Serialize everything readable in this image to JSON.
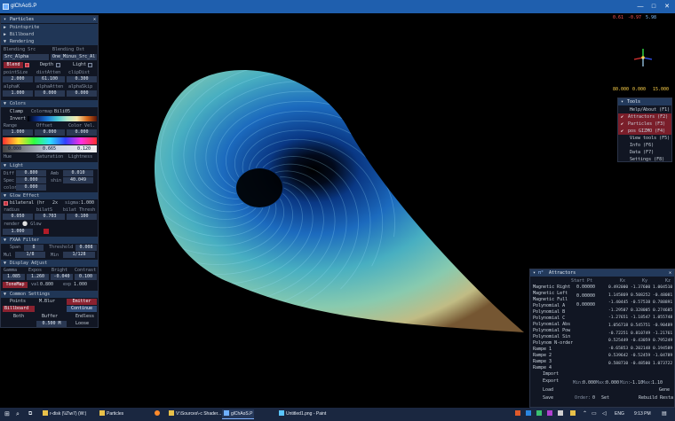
{
  "window": {
    "title": "glChAoS.P",
    "min": "—",
    "max": "□",
    "close": "✕"
  },
  "fps": {
    "v1": "0.61",
    "v2": "-0.97",
    "v3": "5.98"
  },
  "zoom": {
    "a": "80.000",
    "b": "0.000",
    "c": "15.000"
  },
  "left_panel": {
    "title": "Particles",
    "close": "✕",
    "sections": {
      "pointsprite": "Pointsprite",
      "billboard": "Billboard",
      "rendering": "Rendering"
    },
    "blending_src_label": "Blending Src",
    "blending_dst_label": "Blending Dst",
    "blending_src": "Src_Alpha",
    "blending_dst": "One_Minus_Src_Al",
    "blend_btn": "Blend",
    "depth_label": "Depth",
    "light_label": "Light",
    "point_size_label": "pointSize",
    "dist_alpha_label": "distAtten",
    "clipping_label": "clipDist",
    "point_size": "2.000",
    "dist_alpha": "61.100",
    "clipping": "0.300",
    "alpha_k_label": "alphaK",
    "alpha_atten_label": "alphaAtten",
    "alpha_skip_label": "alphaSkip",
    "alpha_k": "1.000",
    "alpha_atten": "0.000",
    "alpha_skip": "0.000",
    "colors": "Colors",
    "clamp": "Clamp",
    "colormap": "Colormap",
    "palette": "Bili05",
    "invert": "Invert",
    "range_label": "Range",
    "offset_label": "Offset",
    "color_vel_label": "Color Vel.",
    "range": "1.000",
    "offset": "0.000",
    "color_vel": "0.000",
    "h_val": "0.000",
    "s_val": "0.665",
    "l_val": "0.120",
    "hue_label": "Hue",
    "sat_label": "Saturation",
    "light2_label": "Lightness",
    "light_section": "Light",
    "diff_label": "Diff",
    "diff": "0.800",
    "amb_label": "Amb",
    "amb": "0.010",
    "spec_label": "Spec",
    "spec": "0.000",
    "shine_label": "shin",
    "shine": "40.049",
    "color_label": "color",
    "color_val": "0.000",
    "glow": "Glow Effect",
    "bilateral": "bilateral (hr",
    "twox": "2x",
    "sigma_label": "sigma:",
    "sigma": "1.000",
    "radius_label": "radius",
    "bilat_label": "bilatS",
    "bilat_thr_label": "bilat Thresh",
    "radius": "0.050",
    "bilat": "0.703",
    "bilat_thr": "0.100",
    "render_glow_label": "render ⚪ Glow",
    "render_glow": "1.000",
    "fxaa": "FXAA Filter",
    "span_label": "Span",
    "span": "8",
    "thresh_label": "Threshold",
    "thresh": "0.008",
    "mul_label": "Mul",
    "mul": "1/8",
    "min_label": "Min",
    "min": "1/128",
    "display": "Display Adjust",
    "gamma_label": "Gamma",
    "expo_label": "Expos",
    "bright_label": "Bright",
    "contrast_label": "Contrast",
    "gamma": "1.085",
    "expo": "1.260",
    "bright": "-0.040",
    "contrast": "0.100",
    "tonemap": "ToneMap",
    "val_label": "val",
    "val": "0.800",
    "exp_label": "exp",
    "exp": "1.000",
    "common": "Common Settings",
    "points": "Points",
    "mblur": "M.Blur",
    "emitter": "Emitter",
    "billboard_btn": "Billboard",
    "continue_btn": "Continue",
    "both": "Both",
    "buffer": "Buffer",
    "endless": "Endless",
    "buffer_val": "0.500 M",
    "emitter_val": "Emitter 1",
    "loose": "Loose"
  },
  "tools": {
    "title": "Tools",
    "items": [
      "Help/About (F1)",
      "Attractors (F2)",
      "Particles (F3)",
      "pos GIZMO (F4)",
      "View tools (F5)",
      "Info (F6)",
      "Data (F7)",
      "Settings (F8)"
    ],
    "checked": [
      false,
      true,
      true,
      true,
      false,
      false,
      false,
      false
    ]
  },
  "attractors": {
    "title": "Attractors",
    "close": "✕",
    "list": [
      "Magnetic Right",
      "Magnetic Left",
      "Magnetic Full",
      "Polynomial A",
      "Polynomial B",
      "Polynomial C",
      "Polynomial Abs",
      "Polynomial Pow",
      "Polynomial Sin",
      "Polynom N-order",
      "Rampe 1",
      "Rampe 2",
      "Rampe 3",
      "Rampe 4"
    ],
    "headers": [
      "Start Pt",
      "Kx",
      "Ky",
      "Kz"
    ],
    "start": [
      "0.00000",
      "0.00000",
      "0.00000"
    ],
    "rows": [
      [
        "0.492000",
        "-1.37600",
        "1.004510"
      ],
      [
        "1.145869",
        "0.508252",
        "-0.48081"
      ],
      [
        "-1.40445",
        "-0.57538",
        "0.788891"
      ],
      [
        "-1.29507",
        "0.328005",
        "0.274685"
      ],
      [
        "-1.27651",
        "-1.18547",
        "1.055748"
      ],
      [
        "1.056718",
        "0.545751",
        "-0.90489"
      ],
      [
        "-0.72251",
        "0.810749",
        "-1.21761"
      ],
      [
        "0.525449",
        "-0.43059",
        "0.795249"
      ],
      [
        "-0.65853",
        "0.202148",
        "0.194589"
      ],
      [
        "0.539642",
        "-0.52459",
        "-1.04789"
      ],
      [
        "0.588710",
        "-0.48500",
        "1.073722"
      ]
    ],
    "import": "Import",
    "export": "Export",
    "load": "Load",
    "save": "Save",
    "order_label": "Order:",
    "order": "0",
    "set": "Set",
    "min_label": "Min:",
    "min_val": "0.000",
    "max_label": "Max:",
    "max_val": "0.000",
    "min2_label": "Min:",
    "min2_val": "-1.10",
    "max2_label": "Max:",
    "max2_val": "1.10",
    "generate": "Gene",
    "rebuild": "Rebuild",
    "restart": "Resta"
  },
  "taskbar": {
    "search_icon": "⌕",
    "items": [
      "r-disk (\\\\Z\\w7) (W:)",
      "Particles",
      "V:\\Sources\\-c Shader...",
      "glChAoS.P",
      "Untitled1.png - Paint"
    ],
    "lang": "ENG",
    "time": "9:13 PM"
  }
}
